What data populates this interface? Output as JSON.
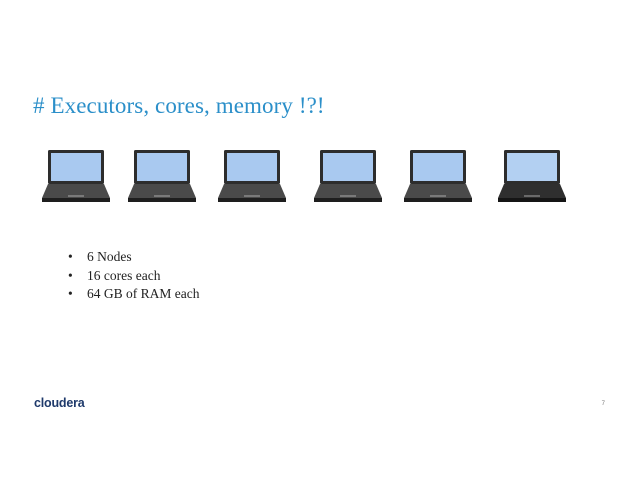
{
  "slide": {
    "title": "# Executors, cores, memory !?!",
    "laptop_icons": [
      "laptop-icon",
      "laptop-icon",
      "laptop-icon",
      "laptop-icon",
      "laptop-icon",
      "laptop-icon"
    ],
    "bullets": [
      {
        "marker": "•",
        "text": "6 Nodes"
      },
      {
        "marker": "•",
        "text": "16 cores each"
      },
      {
        "marker": "•",
        "text": "64 GB of RAM each"
      }
    ],
    "logo_text": "cloudera",
    "page_number": "7"
  },
  "colors": {
    "title": "#2b8fc9",
    "logo": "#1f3a6b",
    "screen": "#a9c9f0",
    "laptop_body": "#4a4a4a"
  }
}
